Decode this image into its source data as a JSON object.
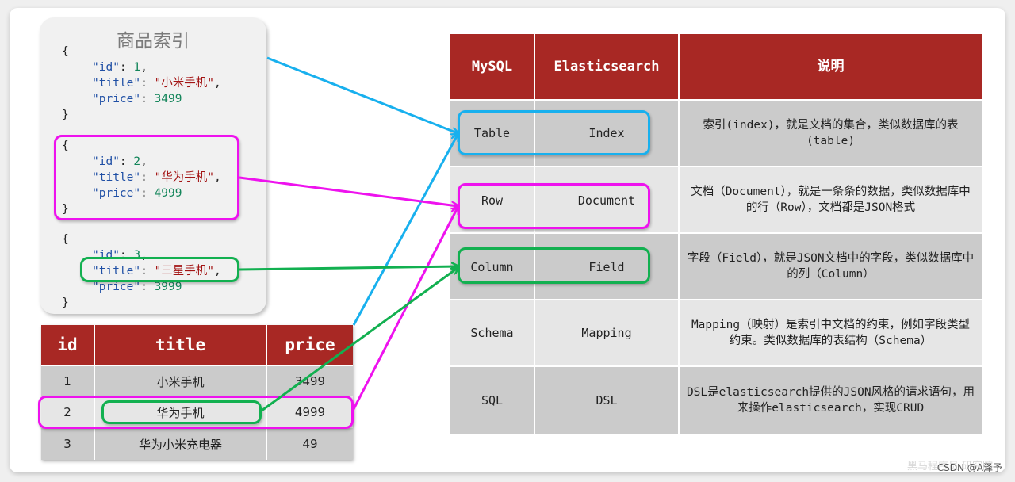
{
  "colors": {
    "header_red": "#a82824",
    "blue": "#18b0ee",
    "pink": "#ee12ee",
    "green": "#12b050",
    "row_dark": "#cbcbcb",
    "row_light": "#e6e6e6"
  },
  "json_panel": {
    "title": "商品索引",
    "docs": [
      {
        "open": "{",
        "id_key": "\"id\"",
        "id_val": "1",
        "title_key": "\"title\"",
        "title_val": "\"小米手机\"",
        "price_key": "\"price\"",
        "price_val": "3499",
        "close": "}"
      },
      {
        "open": "{",
        "id_key": "\"id\"",
        "id_val": "2",
        "title_key": "\"title\"",
        "title_val": "\"华为手机\"",
        "price_key": "\"price\"",
        "price_val": "4999",
        "close": "}"
      },
      {
        "open": "{",
        "id_key": "\"id\"",
        "id_val": "3",
        "title_key": "\"title\"",
        "title_val": "\"三星手机\"",
        "price_key": "\"price\"",
        "price_val": "3999",
        "close": "}"
      }
    ]
  },
  "mysql_table": {
    "headers": [
      "id",
      "title",
      "price"
    ],
    "rows": [
      [
        "1",
        "小米手机",
        "3499"
      ],
      [
        "2",
        "华为手机",
        "4999"
      ],
      [
        "3",
        "华为小米充电器",
        "49"
      ]
    ]
  },
  "comparison_table": {
    "headers": [
      "MySQL",
      "Elasticsearch",
      "说明"
    ],
    "rows": [
      [
        "Table",
        "Index",
        "索引(index)，就是文档的集合，类似数据库的表(table)"
      ],
      [
        "Row",
        "Document",
        "文档（Document），就是一条条的数据，类似数据库中的行（Row），文档都是JSON格式"
      ],
      [
        "Column",
        "Field",
        "字段（Field），就是JSON文档中的字段，类似数据库中的列（Column）"
      ],
      [
        "Schema",
        "Mapping",
        "Mapping（映射）是索引中文档的约束，例如字段类型约束。类似数据库的表结构（Schema）"
      ],
      [
        "SQL",
        "DSL",
        "DSL是elasticsearch提供的JSON风格的请求语句，用来操作elasticsearch，实现CRUD"
      ]
    ]
  },
  "watermark": {
    "faded": "黑马程序员 研究院",
    "text": "CSDN @A泽予"
  }
}
